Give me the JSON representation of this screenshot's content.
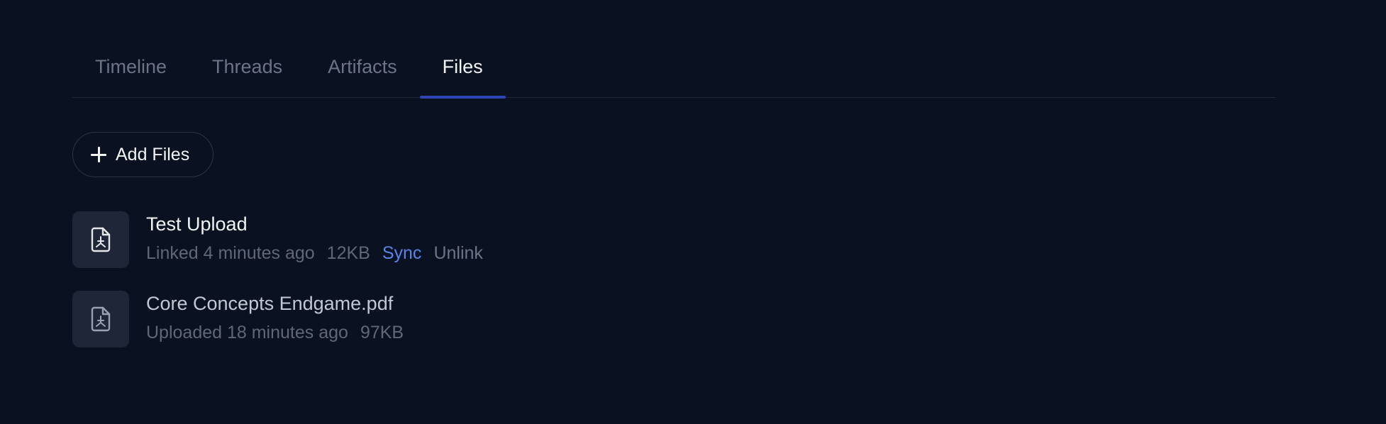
{
  "tabs": [
    {
      "label": "Timeline",
      "active": false
    },
    {
      "label": "Threads",
      "active": false
    },
    {
      "label": "Artifacts",
      "active": false
    },
    {
      "label": "Files",
      "active": true
    }
  ],
  "add_files": {
    "label": "Add Files",
    "icon": "plus-icon"
  },
  "files": [
    {
      "name": "Test Upload",
      "status": "Linked 4 minutes ago",
      "size": "12KB",
      "sync_label": "Sync",
      "unlink_label": "Unlink",
      "icon": "pdf-file-icon"
    },
    {
      "name": "Core Concepts Endgame.pdf",
      "status": "Uploaded 18 minutes ago",
      "size": "97KB",
      "icon": "pdf-file-icon"
    }
  ],
  "colors": {
    "background": "#0a1120",
    "accent": "#2f45b5",
    "link": "#5b84e8"
  }
}
